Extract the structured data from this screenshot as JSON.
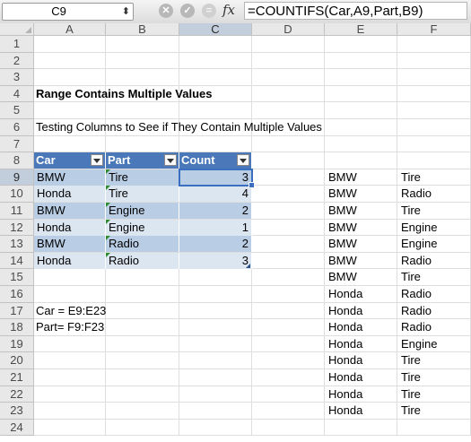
{
  "formula_bar": {
    "name_box": "C9",
    "name_box_arrow": "⬍",
    "cancel_glyph": "✕",
    "enter_glyph": "✓",
    "function_glyph": "=",
    "fx_label": "fx",
    "formula": "=COUNTIFS(Car,A9,Part,B9)"
  },
  "columns": [
    "A",
    "B",
    "C",
    "D",
    "E",
    "F"
  ],
  "selected_column": "C",
  "rows": [
    "1",
    "2",
    "3",
    "4",
    "5",
    "6",
    "7",
    "8",
    "9",
    "10",
    "11",
    "12",
    "13",
    "14",
    "15",
    "16",
    "17",
    "18",
    "19",
    "20",
    "21",
    "22",
    "23",
    "24"
  ],
  "selected_row": "9",
  "text": {
    "title": "Range Contains Multiple Values",
    "subtitle": "Testing Columns to See if They Contain Multiple Values",
    "car_note": "Car = E9:E23",
    "part_note": "Part= F9:F23"
  },
  "table": {
    "headers": [
      "Car",
      "Part",
      "Count"
    ],
    "rows": [
      {
        "car": "BMW",
        "part": "Tire",
        "count": "3"
      },
      {
        "car": "Honda",
        "part": "Tire",
        "count": "4"
      },
      {
        "car": "BMW",
        "part": "Engine",
        "count": "2"
      },
      {
        "car": "Honda",
        "part": "Engine",
        "count": "1"
      },
      {
        "car": "BMW",
        "part": "Radio",
        "count": "2"
      },
      {
        "car": "Honda",
        "part": "Radio",
        "count": "3"
      }
    ]
  },
  "list": [
    {
      "car": "BMW",
      "part": "Tire"
    },
    {
      "car": "BMW",
      "part": "Radio"
    },
    {
      "car": "BMW",
      "part": "Tire"
    },
    {
      "car": "BMW",
      "part": "Engine"
    },
    {
      "car": "BMW",
      "part": "Engine"
    },
    {
      "car": "BMW",
      "part": "Radio"
    },
    {
      "car": "BMW",
      "part": "Tire"
    },
    {
      "car": "Honda",
      "part": "Radio"
    },
    {
      "car": "Honda",
      "part": "Radio"
    },
    {
      "car": "Honda",
      "part": "Radio"
    },
    {
      "car": "Honda",
      "part": "Engine"
    },
    {
      "car": "Honda",
      "part": "Tire"
    },
    {
      "car": "Honda",
      "part": "Tire"
    },
    {
      "car": "Honda",
      "part": "Tire"
    },
    {
      "car": "Honda",
      "part": "Tire"
    }
  ],
  "colors": {
    "table_header": "#4a78b8",
    "band_dark": "#b9cde5",
    "band_light": "#dce6f1",
    "selection": "#3a6fc2"
  }
}
